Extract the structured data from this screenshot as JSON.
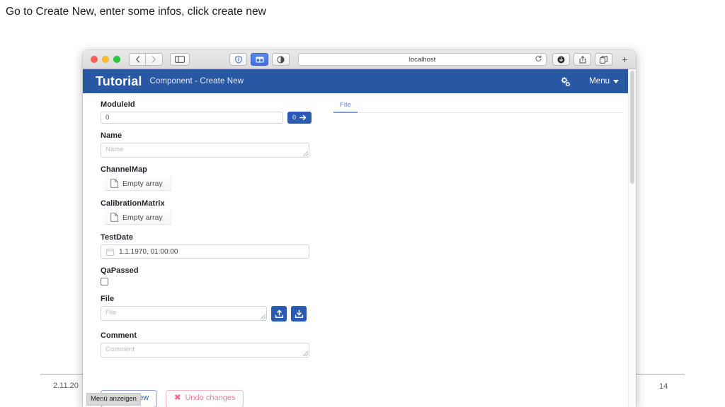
{
  "slide": {
    "title": "Go to Create New, enter some infos, click create new",
    "footer_date": "2.11.20",
    "page_number": "14"
  },
  "browser": {
    "url": "localhost",
    "reload_icon": "reload-icon",
    "back_label": "‹",
    "forward_label": "›",
    "sidebar_icon": "sidebar-icon",
    "shield_icon": "shield-icon",
    "tabs_overview_icon": "tab-overview-icon",
    "reader_icon": "reader-contrast-icon",
    "downloads_icon": "downloads-icon",
    "share_icon": "share-icon",
    "newtab_icon": "new-tab-icon",
    "plus_label": "+"
  },
  "appbar": {
    "brand": "Tutorial",
    "subtitle": "Component - Create New",
    "settings_icon": "gears-icon",
    "menu_label": "Menu",
    "caret_icon": "chevron-down-icon"
  },
  "form": {
    "fields": [
      {
        "label": "ModuleId",
        "value": "0",
        "type": "text"
      },
      {
        "label": "Name",
        "placeholder": "Name",
        "type": "textarea"
      },
      {
        "label": "ChannelMap",
        "chip": "Empty array",
        "type": "file-chip"
      },
      {
        "label": "CalibrationMatrix",
        "chip": "Empty array",
        "type": "file-chip"
      },
      {
        "label": "TestDate",
        "value": "1.1.1970, 01:00:00",
        "type": "date"
      },
      {
        "label": "QaPassed",
        "checked": false,
        "type": "checkbox"
      },
      {
        "label": "File",
        "placeholder": "File",
        "type": "file"
      },
      {
        "label": "Comment",
        "placeholder": "Comment",
        "type": "textarea"
      }
    ],
    "module_id_button_label": "0",
    "module_id_button_icon": "arrow-right-icon",
    "file_upload_icon": "upload-icon",
    "file_download_icon": "download-icon",
    "empty_array_icon": "document-icon",
    "calendar_icon": "calendar-icon"
  },
  "tabs": {
    "items": [
      {
        "label": "File",
        "active": true
      }
    ]
  },
  "actions": {
    "create_label": "Create new",
    "undo_label": "Undo changes",
    "undo_icon": "x-icon",
    "tooltip": "Menü anzeigen"
  },
  "colors": {
    "appbar_blue": "#2857a4",
    "button_blue": "#2a5bb0",
    "danger_pink": "#e3849b",
    "footer_rule": "#c59aae"
  }
}
